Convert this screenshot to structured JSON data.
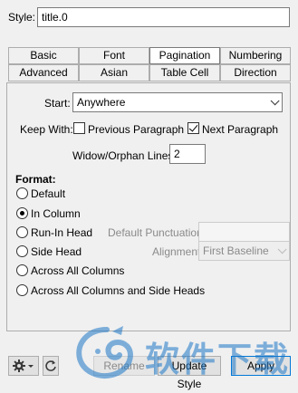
{
  "style": {
    "label": "Style:",
    "value": "title.0"
  },
  "tabs": {
    "row1": [
      "Basic",
      "Font",
      "Pagination",
      "Numbering"
    ],
    "row2": [
      "Advanced",
      "Asian",
      "Table Cell",
      "Direction"
    ],
    "active": "Pagination"
  },
  "pagination": {
    "start_label": "Start:",
    "start_value": "Anywhere",
    "keep_with_label": "Keep With:",
    "prev_paragraph_label": "Previous Paragraph",
    "prev_paragraph_checked": false,
    "next_paragraph_label": "Next Paragraph",
    "next_paragraph_checked": true,
    "widow_orphan_label": "Widow/Orphan Lines:",
    "widow_orphan_value": "2",
    "format_label": "Format:",
    "format_options": [
      "Default",
      "In Column",
      "Run-In Head",
      "Side Head",
      "Across All Columns",
      "Across All Columns and Side Heads"
    ],
    "format_selected": "In Column",
    "default_punctuation_label": "Default Punctuation:",
    "default_punctuation_value": "",
    "alignment_label": "Alignment:",
    "alignment_value": "First Baseline"
  },
  "buttons": {
    "rename": "Rename",
    "update_style": "Update Style",
    "apply": "Apply"
  },
  "icons": {
    "settings": "gear-icon",
    "refresh": "refresh-icon"
  },
  "watermark": {
    "text": "软件下载"
  },
  "colors": {
    "accent": "#0078d7",
    "watermark": "#1e78c8"
  }
}
